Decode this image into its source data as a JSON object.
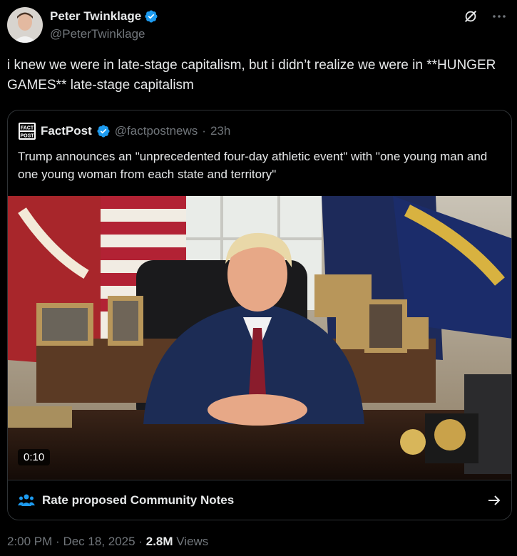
{
  "author": {
    "name": "Peter Twinklage",
    "handle": "@PeterTwinklage"
  },
  "tweet": {
    "text": "i knew we were in late-stage capitalism, but i didn’t realize we were in **HUNGER GAMES** late-stage capitalism"
  },
  "quoted": {
    "name": "FactPost",
    "handle": "@factpostnews",
    "separator": "·",
    "age": "23h",
    "text": "Trump announces an \"unprecedented four-day athletic event\" with \"one young man and one young woman from each state and territory\"",
    "video_time": "0:10",
    "logo_text_top": "FACT",
    "logo_text_bottom": "POST",
    "community_notes_label": "Rate proposed Community Notes"
  },
  "meta": {
    "time": "2:00 PM",
    "sep1": "·",
    "date": "Dec 18, 2025",
    "sep2": "·",
    "views": "2.8M",
    "views_label": "Views"
  },
  "colors": {
    "background": "#000000",
    "text": "#e7e9ea",
    "muted": "#71767b",
    "verified": "#1d9bf0",
    "border": "#2f3336"
  },
  "icons": [
    "verified-badge-icon",
    "grok-icon",
    "more-icon",
    "factpost-logo-icon",
    "community-notes-icon",
    "arrow-right-icon"
  ]
}
